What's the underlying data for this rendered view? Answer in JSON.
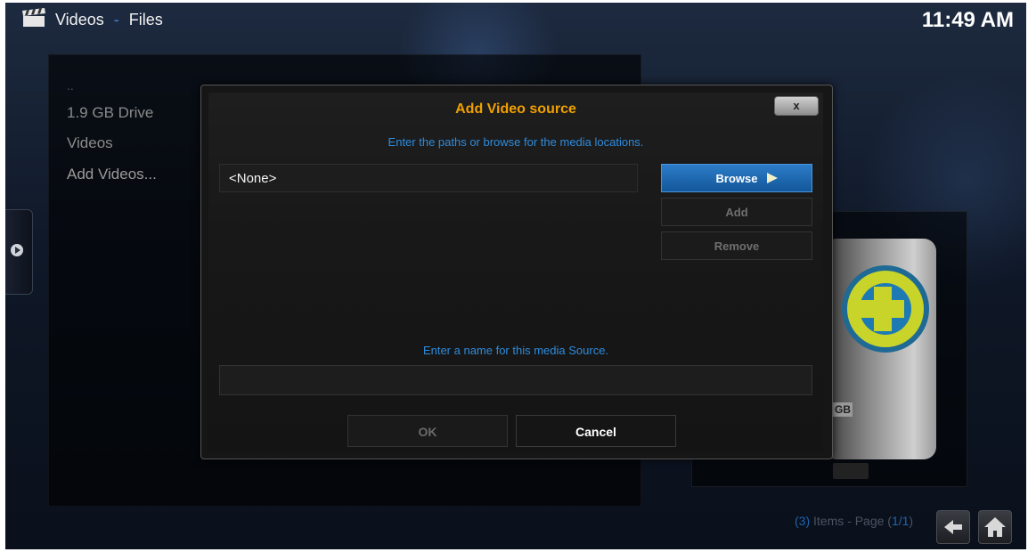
{
  "header": {
    "section": "Videos",
    "separator": "-",
    "subsection": "Files",
    "clock": "11:49 AM"
  },
  "list": {
    "items": [
      "..",
      "1.9 GB Drive",
      "Videos",
      "Add Videos..."
    ]
  },
  "thumbnail": {
    "drive_label": "GB"
  },
  "footer": {
    "count_open": "(",
    "count": "3",
    "count_close": ")",
    "items_text": " Items - Page (",
    "page": "1/1",
    "page_close": ")"
  },
  "dialog": {
    "title": "Add Video source",
    "close_label": "x",
    "path_hint": "Enter the paths or browse for the media locations.",
    "path_value": "<None>",
    "browse_label": "Browse",
    "add_label": "Add",
    "remove_label": "Remove",
    "name_hint": "Enter a name for this media Source.",
    "name_value": "",
    "ok_label": "OK",
    "cancel_label": "Cancel"
  },
  "colors": {
    "title_orange": "#f0a000",
    "hint_blue": "#2e8cdd",
    "focus_blue": "#1e6fbd"
  }
}
